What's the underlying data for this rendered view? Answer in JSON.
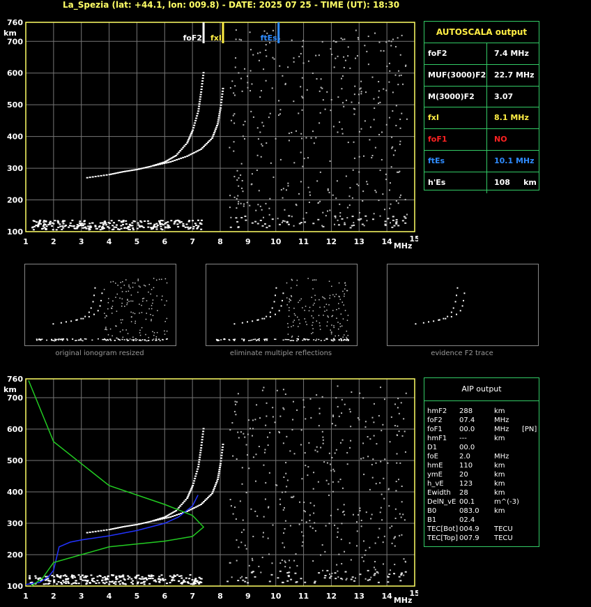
{
  "header": "La_Spezia (lat: +44.1, lon: 009.8) - DATE: 2025 07 25 - TIME (UT): 18:30",
  "colors": {
    "frame": "#ffff66",
    "grid": "#777777",
    "green": "#33cc66",
    "yellow": "#ffee44",
    "blue": "#2f8cff",
    "red": "#ff2222",
    "profile": "#2233ff",
    "model": "#22cc22"
  },
  "chart_data": [
    {
      "type": "scatter",
      "title": "",
      "xlabel": "MHz",
      "ylabel": "km",
      "xlim": [
        1,
        15
      ],
      "ylim": [
        100,
        760
      ],
      "x_ticks": [
        1,
        2,
        3,
        4,
        5,
        6,
        7,
        8,
        9,
        10,
        11,
        12,
        13,
        14,
        15
      ],
      "y_ticks": [
        100,
        200,
        300,
        400,
        500,
        600,
        700,
        760
      ],
      "grid": true,
      "series": [
        {
          "name": "ordinary trace",
          "x": [
            3.2,
            4.0,
            4.5,
            5.0,
            5.5,
            6.0,
            6.4,
            6.8,
            7.0,
            7.2,
            7.3,
            7.4
          ],
          "y": [
            270,
            280,
            289,
            296,
            306,
            320,
            340,
            380,
            420,
            480,
            540,
            610
          ]
        },
        {
          "name": "extraordinary trace",
          "x": [
            5.6,
            6.2,
            6.8,
            7.3,
            7.7,
            7.9,
            8.0,
            8.1
          ],
          "y": [
            308,
            320,
            338,
            360,
            395,
            440,
            490,
            560
          ]
        }
      ],
      "markers": [
        {
          "label": "foF2",
          "x": 7.4
        },
        {
          "label": "fxI",
          "x": 8.1
        },
        {
          "label": "ftEs",
          "x": 10.1
        }
      ]
    },
    {
      "type": "line",
      "title": "",
      "xlabel": "MHz",
      "ylabel": "km",
      "xlim": [
        1,
        15
      ],
      "ylim": [
        100,
        760
      ],
      "x_ticks": [
        1,
        2,
        3,
        4,
        5,
        6,
        7,
        8,
        9,
        10,
        11,
        12,
        13,
        14,
        15
      ],
      "y_ticks": [
        100,
        200,
        300,
        400,
        500,
        600,
        700,
        760
      ],
      "grid": true,
      "series": [
        {
          "name": "true height profile",
          "x": [
            1.0,
            1.5,
            1.8,
            2.0,
            2.2,
            2.6,
            3.0,
            4.0,
            5.0,
            6.0,
            6.5,
            7.0,
            7.2
          ],
          "y": [
            105,
            112,
            128,
            150,
            225,
            240,
            247,
            260,
            277,
            300,
            320,
            355,
            390
          ]
        },
        {
          "name": "model profile",
          "x": [
            1.1,
            2.0,
            4.0,
            6.0,
            7.0,
            7.4,
            7.0,
            6.0,
            4.0,
            2.0,
            1.6,
            1.2
          ],
          "y": [
            755,
            560,
            420,
            360,
            325,
            288,
            258,
            243,
            225,
            175,
            125,
            100
          ]
        }
      ]
    }
  ],
  "autoscala": {
    "title": "AUTOSCALA output",
    "rows": [
      {
        "key": "foF2",
        "value": "7.4 MHz",
        "color": "#ffffff"
      },
      {
        "key": "MUF(3000)F2",
        "value": "22.7 MHz",
        "color": "#ffffff"
      },
      {
        "key": "M(3000)F2",
        "value": "3.07",
        "color": "#ffffff"
      },
      {
        "key": "fxI",
        "value": "8.1 MHz",
        "color": "#ffee44"
      },
      {
        "key": "foF1",
        "value": "NO",
        "color": "#ff2222"
      },
      {
        "key": "ftEs",
        "value": "10.1 MHz",
        "color": "#2f8cff"
      },
      {
        "key": "h'Es",
        "value": "108     km",
        "color": "#ffffff"
      }
    ]
  },
  "thumbnails": [
    {
      "caption": "original ionogram resized"
    },
    {
      "caption": "eliminate multiple reflections"
    },
    {
      "caption": "evidence F2 trace"
    }
  ],
  "aip": {
    "title": "AIP output",
    "rows": [
      [
        "hmF2",
        "288",
        "km",
        ""
      ],
      [
        "foF2",
        "07.4",
        "MHz",
        ""
      ],
      [
        "foF1",
        "00.0",
        "MHz",
        "[PN]"
      ],
      [
        "hmF1",
        "---",
        "km",
        ""
      ],
      [
        "D1",
        "00.0",
        "",
        ""
      ],
      [
        "foE",
        "2.0",
        "MHz",
        ""
      ],
      [
        "hmE",
        "110",
        "km",
        ""
      ],
      [
        "ymE",
        "20",
        "km",
        ""
      ],
      [
        "h_vE",
        "123",
        "km",
        ""
      ],
      [
        "Ewidth",
        "28",
        "km",
        ""
      ],
      [
        "DelN_vE",
        "00.1",
        "m^(-3)",
        ""
      ],
      [
        "B0",
        "083.0",
        "km",
        ""
      ],
      [
        "B1",
        "02.4",
        "",
        ""
      ],
      [
        "TEC[Bot]",
        "004.9",
        "TECU",
        ""
      ],
      [
        "TEC[Top]",
        "007.9",
        "TECU",
        ""
      ]
    ]
  }
}
